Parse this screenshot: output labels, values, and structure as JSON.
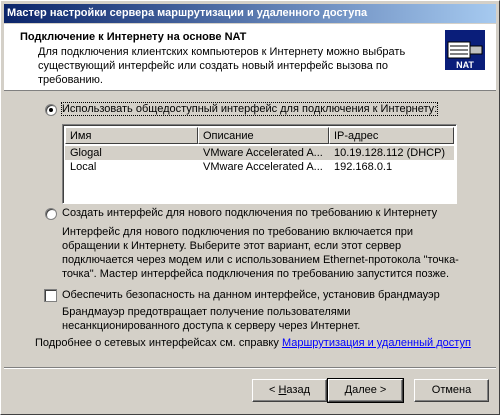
{
  "window": {
    "title": "Мастер настройки сервера маршрутизации и удаленного доступа"
  },
  "header": {
    "title": "Подключение к Интернету на основе NAT",
    "subtitle": "Для подключения клиентских компьютеров к Интернету можно выбрать существующий интерфейс или создать новый интерфейс вызова по требованию.",
    "icon": "nat-icon",
    "icon_text": "NAT"
  },
  "option_existing": {
    "label": "Использовать общедоступный интерфейс для подключения к Интернету:",
    "checked": true
  },
  "interfaces": {
    "columns": [
      "Имя",
      "Описание",
      "IP-адрес"
    ],
    "rows": [
      {
        "name": "Glogal",
        "description": "VMware Accelerated A...",
        "ip": "10.19.128.112 (DHCP)",
        "selected": true
      },
      {
        "name": "Local",
        "description": "VMware Accelerated A...",
        "ip": "192.168.0.1",
        "selected": false
      }
    ]
  },
  "option_demand": {
    "label": "Создать интерфейс для нового подключения по требованию к Интернету",
    "checked": false,
    "description": "Интерфейс для нового подключения по требованию включается при обращении к Интернету. Выберите этот вариант, если этот сервер подключается через модем или с использованием Ethernet-протокола \"точка-точка\". Мастер интерфейса подключения по требованию запустится позже."
  },
  "firewall": {
    "label": "Обеспечить безопасность на данном интерфейсе, установив брандмауэр",
    "checked": false,
    "description": "Брандмауэр предотвращает получение пользователями несанкционированного доступа к серверу через Интернет."
  },
  "help": {
    "text": "Подробнее о сетевых интерфейсах см. справку",
    "link": "Маршрутизация и удаленный доступ"
  },
  "buttons": {
    "back_prefix": "< ",
    "back_key": "Н",
    "back_rest": "азад",
    "next_prefix": "",
    "next_key": "Д",
    "next_rest": "алее >",
    "cancel": "Отмена"
  },
  "colors": {
    "title_gradient_start": "#0a246a",
    "title_gradient_end": "#a6caf0",
    "dialog_bg": "#d4d0c8",
    "link": "#0000ff"
  }
}
